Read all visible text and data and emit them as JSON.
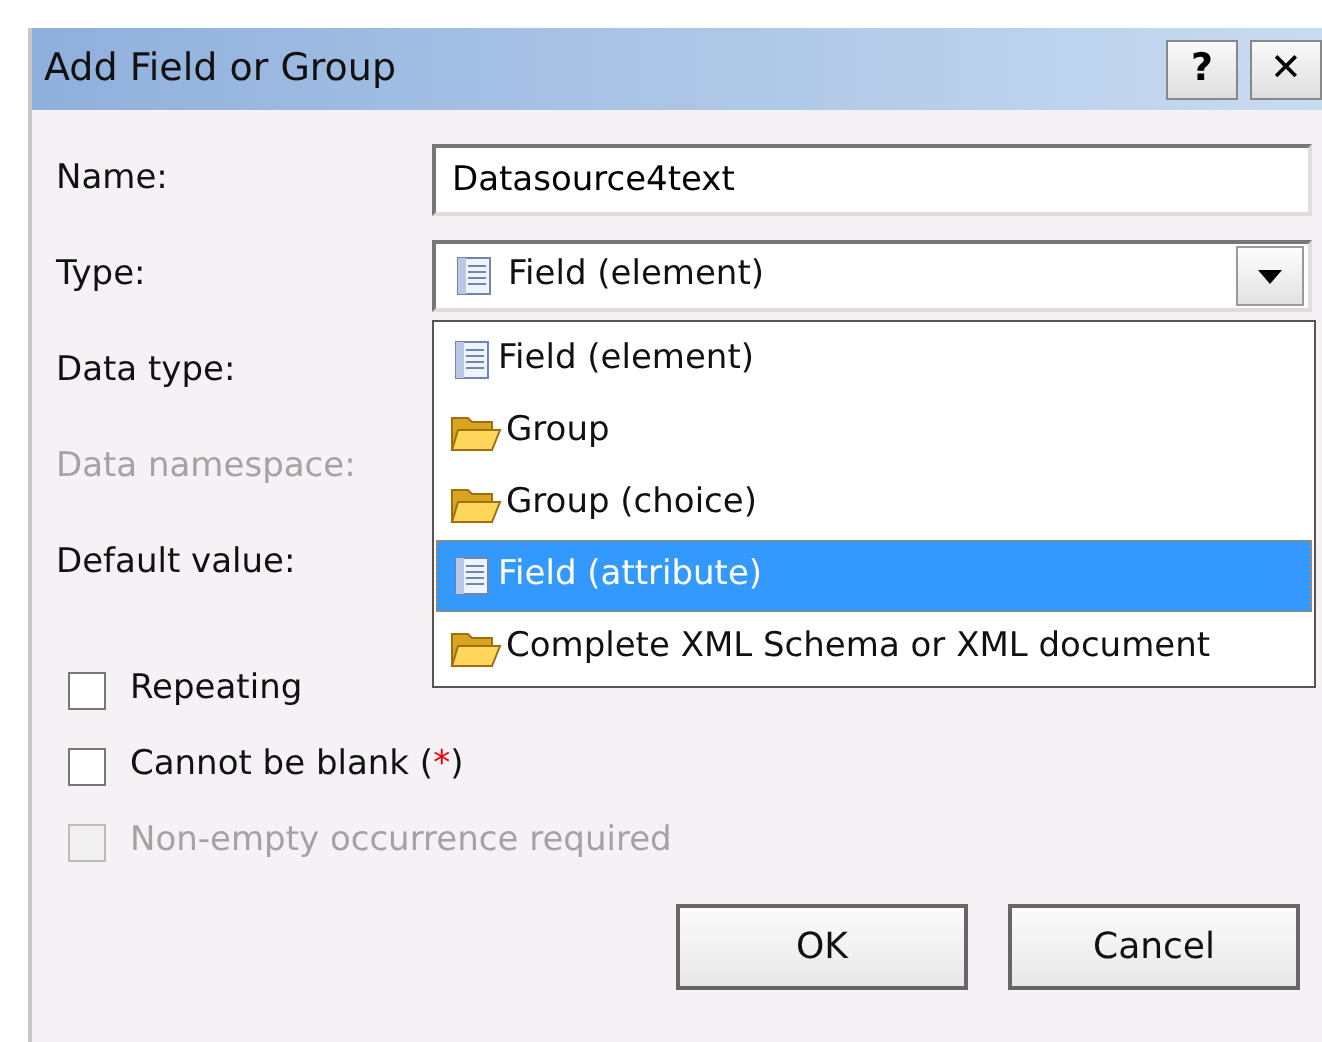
{
  "window": {
    "title": "Add Field or Group",
    "buttons": [
      "?",
      "✕"
    ]
  },
  "fields": [
    {
      "label": "Name:",
      "kind": "text",
      "value": "Datasource4text",
      "disabled": false
    },
    {
      "label": "Type:",
      "kind": "combo",
      "selection": {
        "label": "Field (element)",
        "kind": "field"
      },
      "disabled": false
    },
    {
      "label": "Data type:",
      "kind": "hidden",
      "disabled": false
    },
    {
      "label": "Data namespace:",
      "kind": "hidden",
      "disabled": true
    },
    {
      "label": "Default value:",
      "kind": "hidden",
      "disabled": false
    }
  ],
  "dropdown": {
    "items": [
      {
        "label": "Field (element)",
        "kind": "field",
        "selected": false
      },
      {
        "label": "Group",
        "kind": "folder",
        "selected": false
      },
      {
        "label": "Group (choice)",
        "kind": "folder",
        "selected": false
      },
      {
        "label": "Field (attribute)",
        "kind": "field",
        "selected": true
      },
      {
        "label": "Complete XML Schema or XML document",
        "kind": "folder",
        "selected": false
      }
    ]
  },
  "checkboxes": [
    {
      "label": "Repeating",
      "checked": false,
      "disabled": false
    },
    {
      "label": "Cannot be blank",
      "checked": false,
      "disabled": false,
      "marker": [
        {
          "text": "(",
          "kind": "plain"
        },
        {
          "text": "*",
          "kind": "required"
        },
        {
          "text": ")",
          "kind": "plain"
        }
      ]
    },
    {
      "label": "Non-empty occurrence required",
      "checked": false,
      "disabled": true
    }
  ],
  "buttons": [
    "OK",
    "Cancel"
  ]
}
